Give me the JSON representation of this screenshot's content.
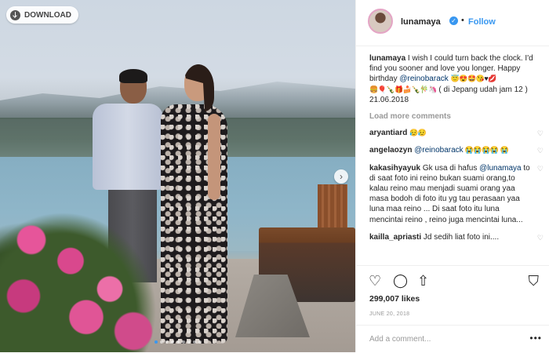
{
  "photo": {
    "download_label": "DOWNLOAD",
    "carousel_count": 9,
    "carousel_active": 0
  },
  "header": {
    "username": "lunamaya",
    "separator": "•",
    "follow_label": "Follow"
  },
  "caption": {
    "username": "lunamaya",
    "text_before_mention": " I wish I could turn back the clock. I'd find you sooner and love you longer. Happy birthday ",
    "mention": "@reinobarack",
    "emoji_line1": "😇😍🤩😘♥💋",
    "emoji_line2": "🍔🎈🍾🎁🍰🍾🎋🦄",
    "text_after": " ( di Jepang udah jam 12 ) 21.06.2018"
  },
  "load_more": "Load more comments",
  "comments": [
    {
      "username": "aryantiard",
      "pre": " ",
      "mention": "",
      "text": "😥😥"
    },
    {
      "username": "angelaozyn",
      "pre": " ",
      "mention": "@reinobarack",
      "text": " 😭😭😭😭 😭"
    },
    {
      "username": "kakasihyayuk",
      "pre": " Gk usa di hafus ",
      "mention": "@lunamaya",
      "text": " to di saat foto ini reino bukan suami orang,to kalau reino mau menjadi suami orang yaa masa bodoh di foto itu yg tau perasaan yaa luna maa reino ... Di saat foto itu luna mencintai reino , reino juga mencintai luna..."
    },
    {
      "username": "kailla_apriasti",
      "pre": " Jd sedih liat foto ini....",
      "mention": "",
      "text": ""
    }
  ],
  "likes": "299,007 likes",
  "date": "JUNE 20, 2018",
  "add_comment_placeholder": "Add a comment...",
  "more_options": "•••",
  "icons": {
    "heart": "♡",
    "comment": "◯",
    "share": "⇧",
    "bookmark": "⛉"
  },
  "colors": {
    "link": "#003569",
    "accent": "#3897f0",
    "muted": "#999999"
  }
}
